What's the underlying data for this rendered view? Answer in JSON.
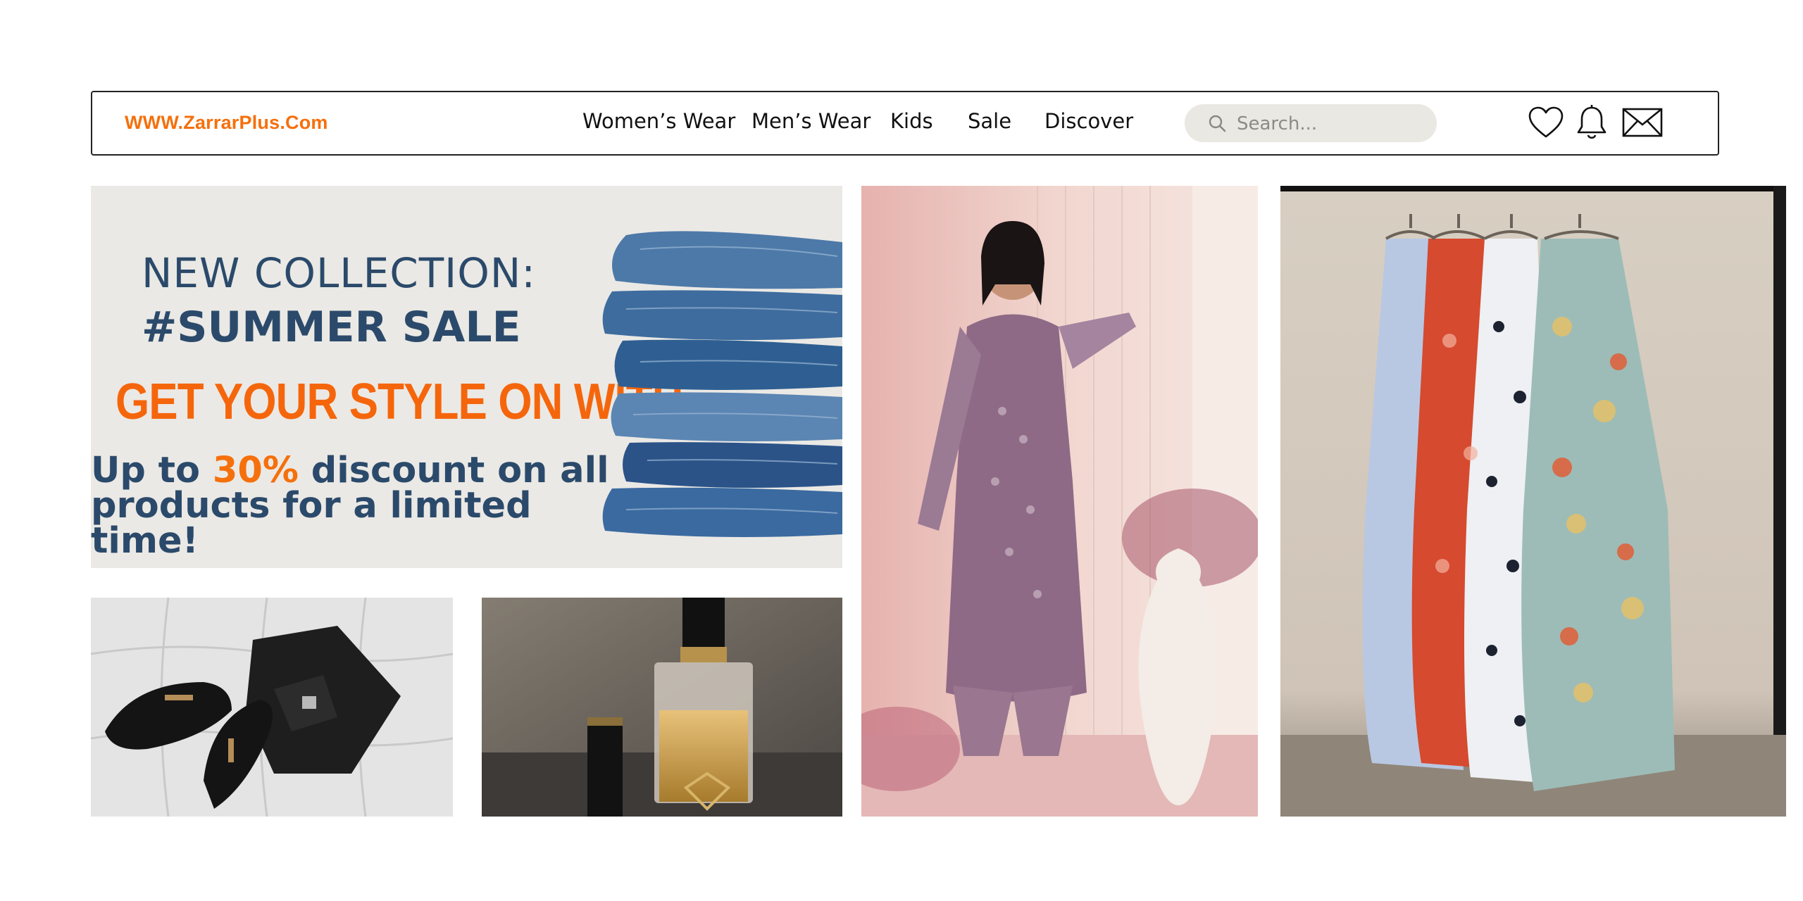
{
  "nav": {
    "logo": "WWW.ZarrarPlus.Com",
    "menu": [
      "Women’s Wear",
      "Men’s Wear",
      "Kids",
      "Sale",
      "Discover"
    ],
    "search_placeholder": "Search...",
    "icons": [
      "heart-icon",
      "bell-icon",
      "mail-icon"
    ]
  },
  "banner": {
    "line1": "NEW COLLECTION:",
    "line2": "#SUMMER SALE",
    "line3": "GET YOUR STYLE ON WITH",
    "line4_prefix": "Up to",
    "line4_accent": "30%",
    "line4_suffix": "discount on all",
    "line5": "products for a limited time!"
  },
  "colors": {
    "accent": "#f5700c",
    "navy": "#2b4a6b",
    "banner_bg": "#ebe9e5",
    "search_bg": "#eae8e2"
  }
}
